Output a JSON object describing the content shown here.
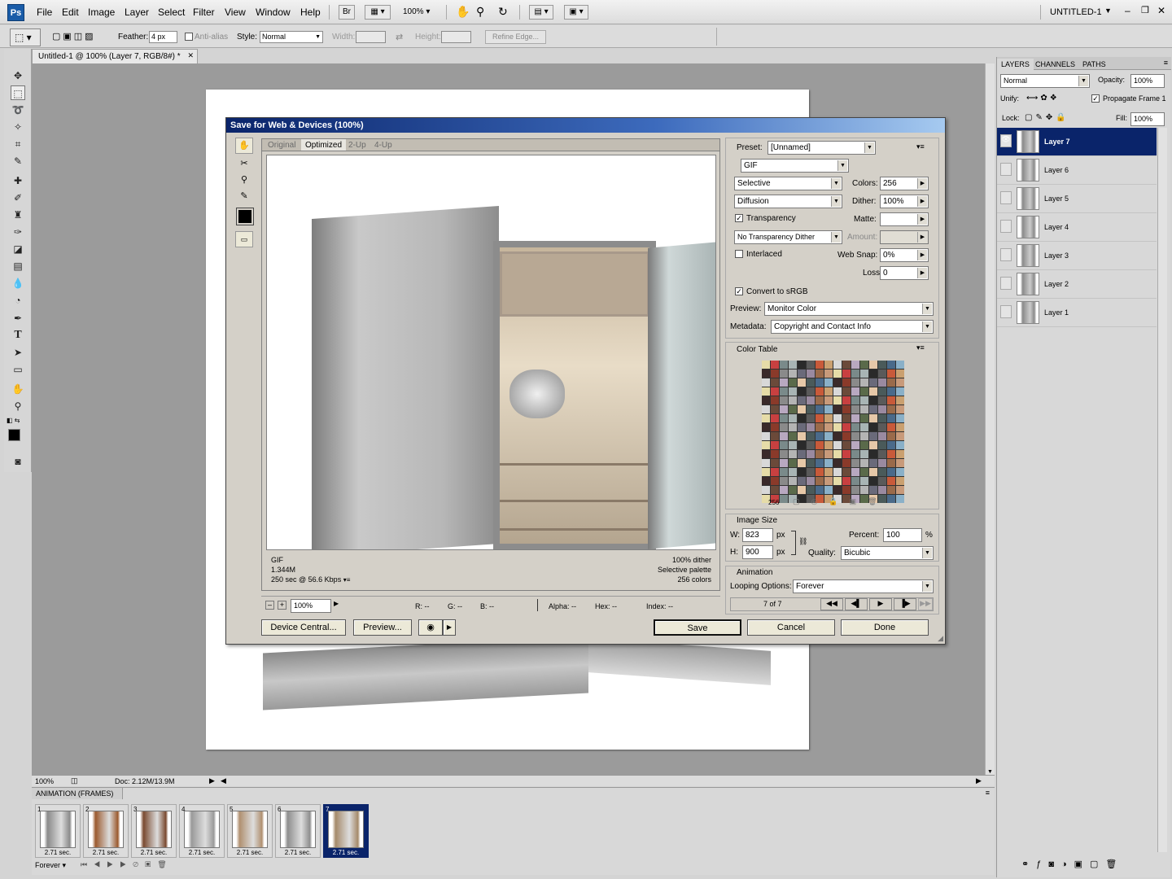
{
  "app": {
    "logo": "Ps",
    "doc_name": "UNTITLED-1"
  },
  "menu": [
    "File",
    "Edit",
    "Image",
    "Layer",
    "Select",
    "Filter",
    "View",
    "Window",
    "Help"
  ],
  "menubar": {
    "bridge_label": "Br",
    "zoom_label": "100%"
  },
  "options": {
    "feather_label": "Feather:",
    "feather_value": "4 px",
    "antialias_label": "Anti-alias",
    "style_label": "Style:",
    "style_value": "Normal",
    "width_label": "Width:",
    "height_label": "Height:",
    "refine_label": "Refine Edge..."
  },
  "document": {
    "tab_title": "Untitled-1 @ 100% (Layer 7, RGB/8#) *",
    "close_glyph": "✕"
  },
  "status": {
    "zoom": "100%",
    "doc_size": "Doc: 2.12M/13.9M"
  },
  "animation": {
    "tab_title": "ANIMATION (FRAMES)",
    "looping": "Forever",
    "frames": [
      {
        "num": "1",
        "delay": "2.71 sec."
      },
      {
        "num": "2",
        "delay": "2.71 sec."
      },
      {
        "num": "3",
        "delay": "2.71 sec."
      },
      {
        "num": "4",
        "delay": "2.71 sec."
      },
      {
        "num": "5",
        "delay": "2.71 sec."
      },
      {
        "num": "6",
        "delay": "2.71 sec."
      },
      {
        "num": "7",
        "delay": "2.71 sec."
      }
    ],
    "selected_frame": 7
  },
  "layers_panel": {
    "tabs": [
      "LAYERS",
      "CHANNELS",
      "PATHS"
    ],
    "blend_mode": "Normal",
    "opacity_label": "Opacity:",
    "opacity_value": "100%",
    "unify_label": "Unify:",
    "propagate_label": "Propagate Frame 1",
    "lock_label": "Lock:",
    "fill_label": "Fill:",
    "fill_value": "100%",
    "layers": [
      "Layer 7",
      "Layer 6",
      "Layer 5",
      "Layer 4",
      "Layer 3",
      "Layer 2",
      "Layer 1"
    ],
    "selected_layer": "Layer 7"
  },
  "dialog": {
    "title": "Save for Web & Devices (100%)",
    "view_tabs": [
      "Original",
      "Optimized",
      "2-Up",
      "4-Up"
    ],
    "active_tab": "Optimized",
    "preview_info_left": [
      "GIF",
      "1.344M",
      "250 sec @ 56.6 Kbps"
    ],
    "preview_info_right": [
      "100% dither",
      "Selective palette",
      "256 colors"
    ],
    "zoom_value": "100%",
    "readouts": {
      "r": "R: --",
      "g": "G: --",
      "b": "B: --",
      "alpha": "Alpha: --",
      "hex": "Hex: --",
      "index": "Index: --"
    },
    "buttons": {
      "device_central": "Device Central...",
      "preview": "Preview...",
      "save": "Save",
      "cancel": "Cancel",
      "done": "Done"
    },
    "preset_label": "Preset:",
    "preset_value": "[Unnamed]",
    "format": "GIF",
    "reduction": "Selective",
    "colors_label": "Colors:",
    "colors_value": "256",
    "dither_algo": "Diffusion",
    "dither_label": "Dither:",
    "dither_value": "100%",
    "transparency_label": "Transparency",
    "matte_label": "Matte:",
    "trans_dither": "No Transparency Dither",
    "amount_label": "Amount:",
    "interlaced_label": "Interlaced",
    "websnap_label": "Web Snap:",
    "websnap_value": "0%",
    "lossy_label": "Lossy:",
    "lossy_value": "0",
    "convert_label": "Convert to sRGB",
    "preview_label": "Preview:",
    "preview_value": "Monitor Color",
    "metadata_label": "Metadata:",
    "metadata_value": "Copyright and Contact Info",
    "color_table_label": "Color Table",
    "color_count": "256",
    "image_size_label": "Image Size",
    "w_label": "W:",
    "w_value": "823",
    "h_label": "H:",
    "h_value": "900",
    "px": "px",
    "percent_label": "Percent:",
    "percent_value": "100",
    "percent_sign": "%",
    "quality_label": "Quality:",
    "quality_value": "Bicubic",
    "animation_label": "Animation",
    "looping_label": "Looping Options:",
    "looping_value": "Forever",
    "frame_counter": "7 of 7"
  },
  "colors": {
    "title_bar": "#0a246a",
    "selection": "#0a246a",
    "dialog_bg": "#d4d0c8"
  }
}
